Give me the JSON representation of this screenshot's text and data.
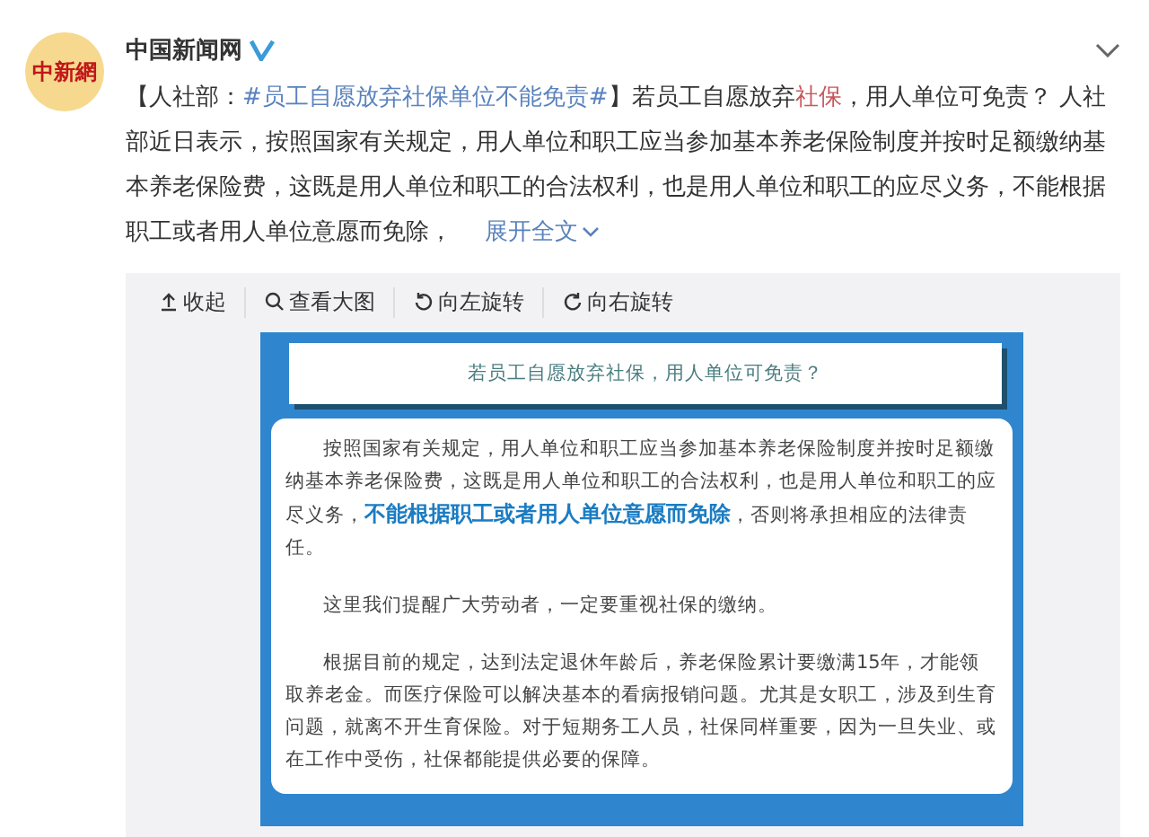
{
  "post": {
    "avatar_text": "中新網",
    "author": "中国新闻网",
    "verified": true,
    "content": [
      {
        "kind": "text",
        "text": "【人社部："
      },
      {
        "kind": "hashtag",
        "text": "#员工自愿放弃社保单位不能免责#"
      },
      {
        "kind": "text",
        "text": "】若员工自愿放弃"
      },
      {
        "kind": "keyword",
        "text": "社保"
      },
      {
        "kind": "text",
        "text": "，用人单位可免责？ 人社部近日表示，按照国家有关规定，用人单位和职工应当参加基本养老保险制度并按时足额缴纳基本养老保险费，这既是用人单位和职工的合法权利，也是用人单位和职工的应尽义务，不能根据职工或者用人单位意愿而免除，"
      }
    ],
    "expand": "展开全文"
  },
  "toolbar": [
    {
      "kind": "collapse",
      "label": "收起"
    },
    {
      "kind": "zoom",
      "label": "查看大图"
    },
    {
      "kind": "rotate_left",
      "label": "向左旋转"
    },
    {
      "kind": "rotate_right",
      "label": "向右旋转"
    }
  ],
  "image": {
    "title": "若员工自愿放弃社保，用人单位可免责？",
    "paragraphs": [
      [
        {
          "kind": "text",
          "text": "按照国家有关规定，用人单位和职工应当参加基本养老保险制度并按时足额缴纳基本养老保险费，这既是用人单位和职工的合法权利，也是用人单位和职工的应尽义务，"
        },
        {
          "kind": "emphasis",
          "text": "不能根据职工或者用人单位意愿而免除"
        },
        {
          "kind": "text",
          "text": "，否则将承担相应的法律责任。"
        }
      ],
      [
        {
          "kind": "text",
          "text": "这里我们提醒广大劳动者，一定要重视社保的缴纳。"
        }
      ],
      [
        {
          "kind": "text",
          "text": "根据目前的规定，达到法定退休年龄后，养老保险累计要缴满15年，才能领取养老金。而医疗保险可以解决基本的看病报销问题。尤其是女职工，涉及到生育问题，就离不开生育保险。对于短期务工人员，社保同样重要，因为一旦失业、或在工作中受伤，社保都能提供必要的保障。"
        }
      ]
    ]
  }
}
